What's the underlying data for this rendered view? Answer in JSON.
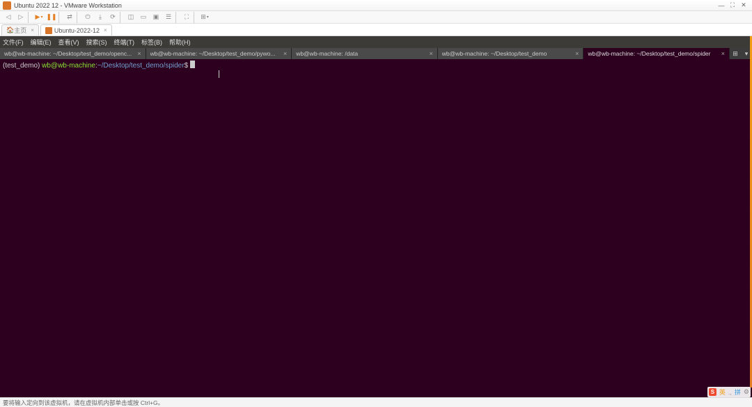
{
  "window": {
    "title": "Ubuntu 2022 12 - VMware Workstation",
    "min": "—",
    "max": "⛶",
    "close": "✕"
  },
  "toolbar": {
    "play": "▶",
    "pause": "❚❚",
    "i1": "⇄",
    "i2": "⤓",
    "i3": "⏻",
    "i4": "⟳",
    "i5": "◫",
    "i6": "▭",
    "i7": "▣",
    "i8": "☰",
    "i9": "⛶",
    "i10": "⊞",
    "dropdown": "▾"
  },
  "vmtabs": {
    "home": "主页",
    "homeclose": "×",
    "vm": "Ubuntu-2022-12",
    "vmclose": "×"
  },
  "ubuntu_menu": {
    "file": "文件(F)",
    "edit": "编辑(E)",
    "view": "查看(V)",
    "search": "搜索(S)",
    "terminal": "终端(T)",
    "tabs": "标签(B)",
    "help": "帮助(H)"
  },
  "term_tabs": [
    {
      "label": "wb@wb-machine: ~/Desktop/test_demo/openc...",
      "active": false
    },
    {
      "label": "wb@wb-machine: ~/Desktop/test_demo/pywo...",
      "active": false
    },
    {
      "label": "wb@wb-machine: /data",
      "active": false
    },
    {
      "label": "wb@wb-machine: ~/Desktop/test_demo",
      "active": false
    },
    {
      "label": "wb@wb-machine: ~/Desktop/test_demo/spider",
      "active": true
    }
  ],
  "term_ctrl": {
    "menu": "⊞",
    "drop": "▾"
  },
  "prompt": {
    "env": "(test_demo) ",
    "userhost": "wb@wb-machine",
    "colon": ":",
    "path": "~/Desktop/test_demo/spider",
    "dollar": "$ "
  },
  "statusbar": {
    "text": "要将输入定向到该虚拟机，请在虚拟机内部单击或按 Ctrl+G。"
  },
  "ime": {
    "s": "S",
    "lang": "英",
    "sep1": ".,",
    "pin": "拼",
    "tool": "⚙"
  }
}
